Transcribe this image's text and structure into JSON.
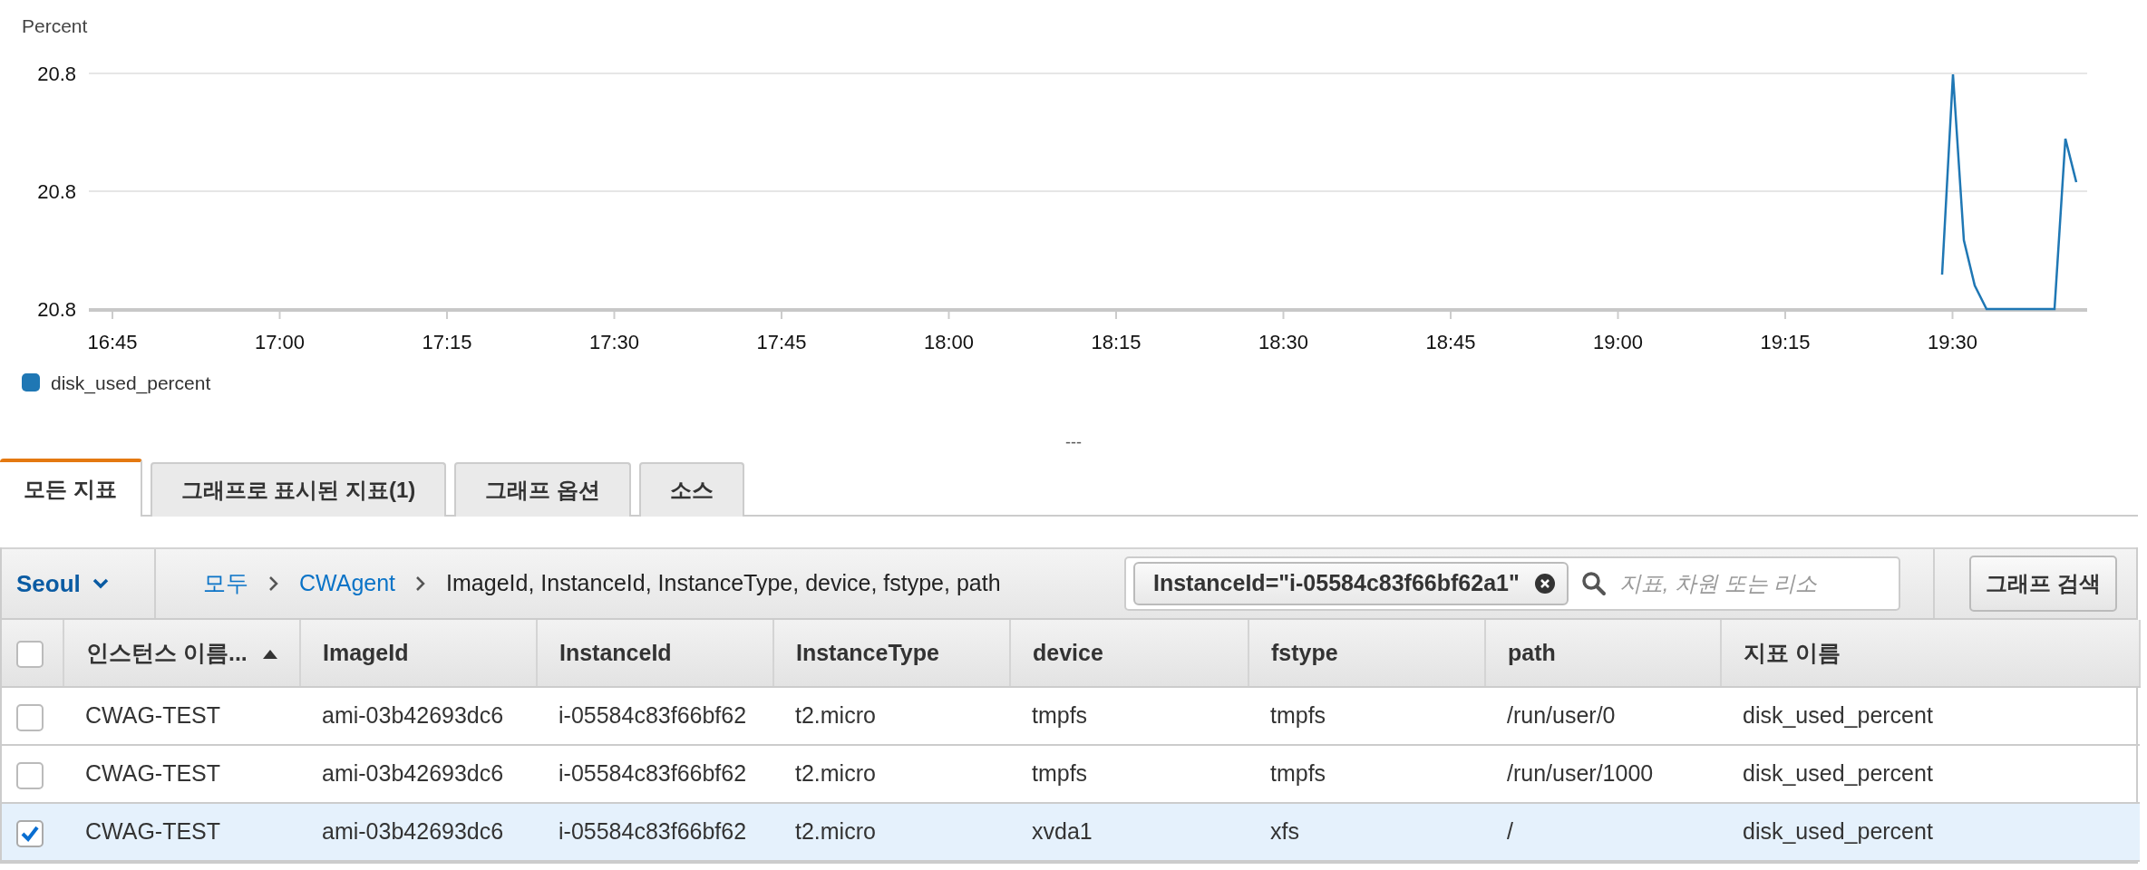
{
  "chart": {
    "y_axis_label": "Percent",
    "y_tick_labels": [
      "20.8",
      "20.8",
      "20.8"
    ],
    "x_tick_labels": [
      "16:45",
      "17:00",
      "17:15",
      "17:30",
      "17:45",
      "18:00",
      "18:15",
      "18:30",
      "18:45",
      "19:00",
      "19:15",
      "19:30"
    ],
    "legend": [
      {
        "name": "disk_used_percent",
        "color": "#1f77b4"
      }
    ]
  },
  "divider_handle": "---",
  "tabs": [
    {
      "label": "모든 지표",
      "selected": true
    },
    {
      "label": "그래프로 표시된 지표(1)",
      "selected": false
    },
    {
      "label": "그래프 옵션",
      "selected": false
    },
    {
      "label": "소스",
      "selected": false
    }
  ],
  "filter_bar": {
    "region": "Seoul",
    "breadcrumb": [
      {
        "label": "모두",
        "link": true
      },
      {
        "label": "CWAgent",
        "link": true
      },
      {
        "label": "ImageId, InstanceId, InstanceType, device, fstype, path",
        "link": false
      }
    ],
    "filter_token": "InstanceId=\"i-05584c83f66bf62a1\"",
    "search": {
      "placeholder": "지표, 차원 또는 리소"
    },
    "button": "그래프 검색"
  },
  "table": {
    "all_checked": false,
    "columns": [
      {
        "label": "인스턴스 이름...",
        "sorted": true
      },
      {
        "label": "ImageId",
        "sorted": false
      },
      {
        "label": "InstanceId",
        "sorted": false
      },
      {
        "label": "InstanceType",
        "sorted": false
      },
      {
        "label": "device",
        "sorted": false
      },
      {
        "label": "fstype",
        "sorted": false
      },
      {
        "label": "path",
        "sorted": false
      },
      {
        "label": "지표 이름",
        "sorted": false
      }
    ],
    "rows": [
      {
        "checked": false,
        "cells": [
          "CWAG-TEST",
          "ami-03b42693dc6",
          "i-05584c83f66bf62",
          "t2.micro",
          "tmpfs",
          "tmpfs",
          "/run/user/0",
          "disk_used_percent"
        ]
      },
      {
        "checked": false,
        "cells": [
          "CWAG-TEST",
          "ami-03b42693dc6",
          "i-05584c83f66bf62",
          "t2.micro",
          "tmpfs",
          "tmpfs",
          "/run/user/1000",
          "disk_used_percent"
        ]
      },
      {
        "checked": true,
        "cells": [
          "CWAG-TEST",
          "ami-03b42693dc6",
          "i-05584c83f66bf62",
          "t2.micro",
          "xvda1",
          "xfs",
          "/",
          "disk_used_percent"
        ]
      }
    ]
  }
}
